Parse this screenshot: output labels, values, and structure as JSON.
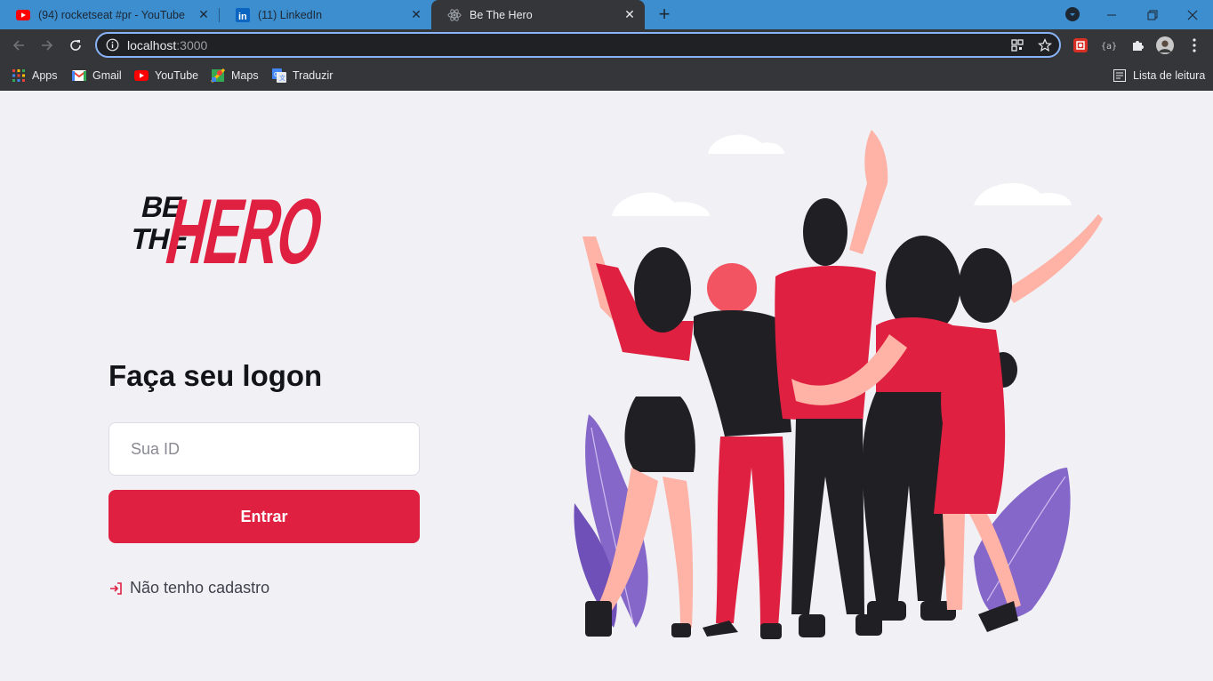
{
  "browser": {
    "tabs": [
      {
        "title": "(94) rocketseat #pr - YouTube",
        "icon": "youtube-icon"
      },
      {
        "title": "(11) LinkedIn",
        "icon": "linkedin-icon"
      },
      {
        "title": "Be The Hero",
        "icon": "react-icon",
        "active": true
      }
    ],
    "address": {
      "host": "localhost",
      "port": ":3000"
    },
    "bookmarks": [
      {
        "label": "Apps",
        "icon": "apps-grid-icon"
      },
      {
        "label": "Gmail",
        "icon": "gmail-icon"
      },
      {
        "label": "YouTube",
        "icon": "youtube-icon"
      },
      {
        "label": "Maps",
        "icon": "maps-icon"
      },
      {
        "label": "Traduzir",
        "icon": "translate-icon"
      }
    ],
    "reading_list": "Lista de leitura"
  },
  "logo": {
    "top_word": "BE",
    "mid_word": "THE",
    "main_word": "HERO"
  },
  "login": {
    "title": "Faça seu logon",
    "id_placeholder": "Sua ID",
    "submit_label": "Entrar",
    "register_link": "Não tenho cadastro"
  },
  "colors": {
    "brand_red": "#e02041",
    "background": "#f0f0f5",
    "text_dark": "#13131a",
    "text_muted": "#41414d"
  }
}
